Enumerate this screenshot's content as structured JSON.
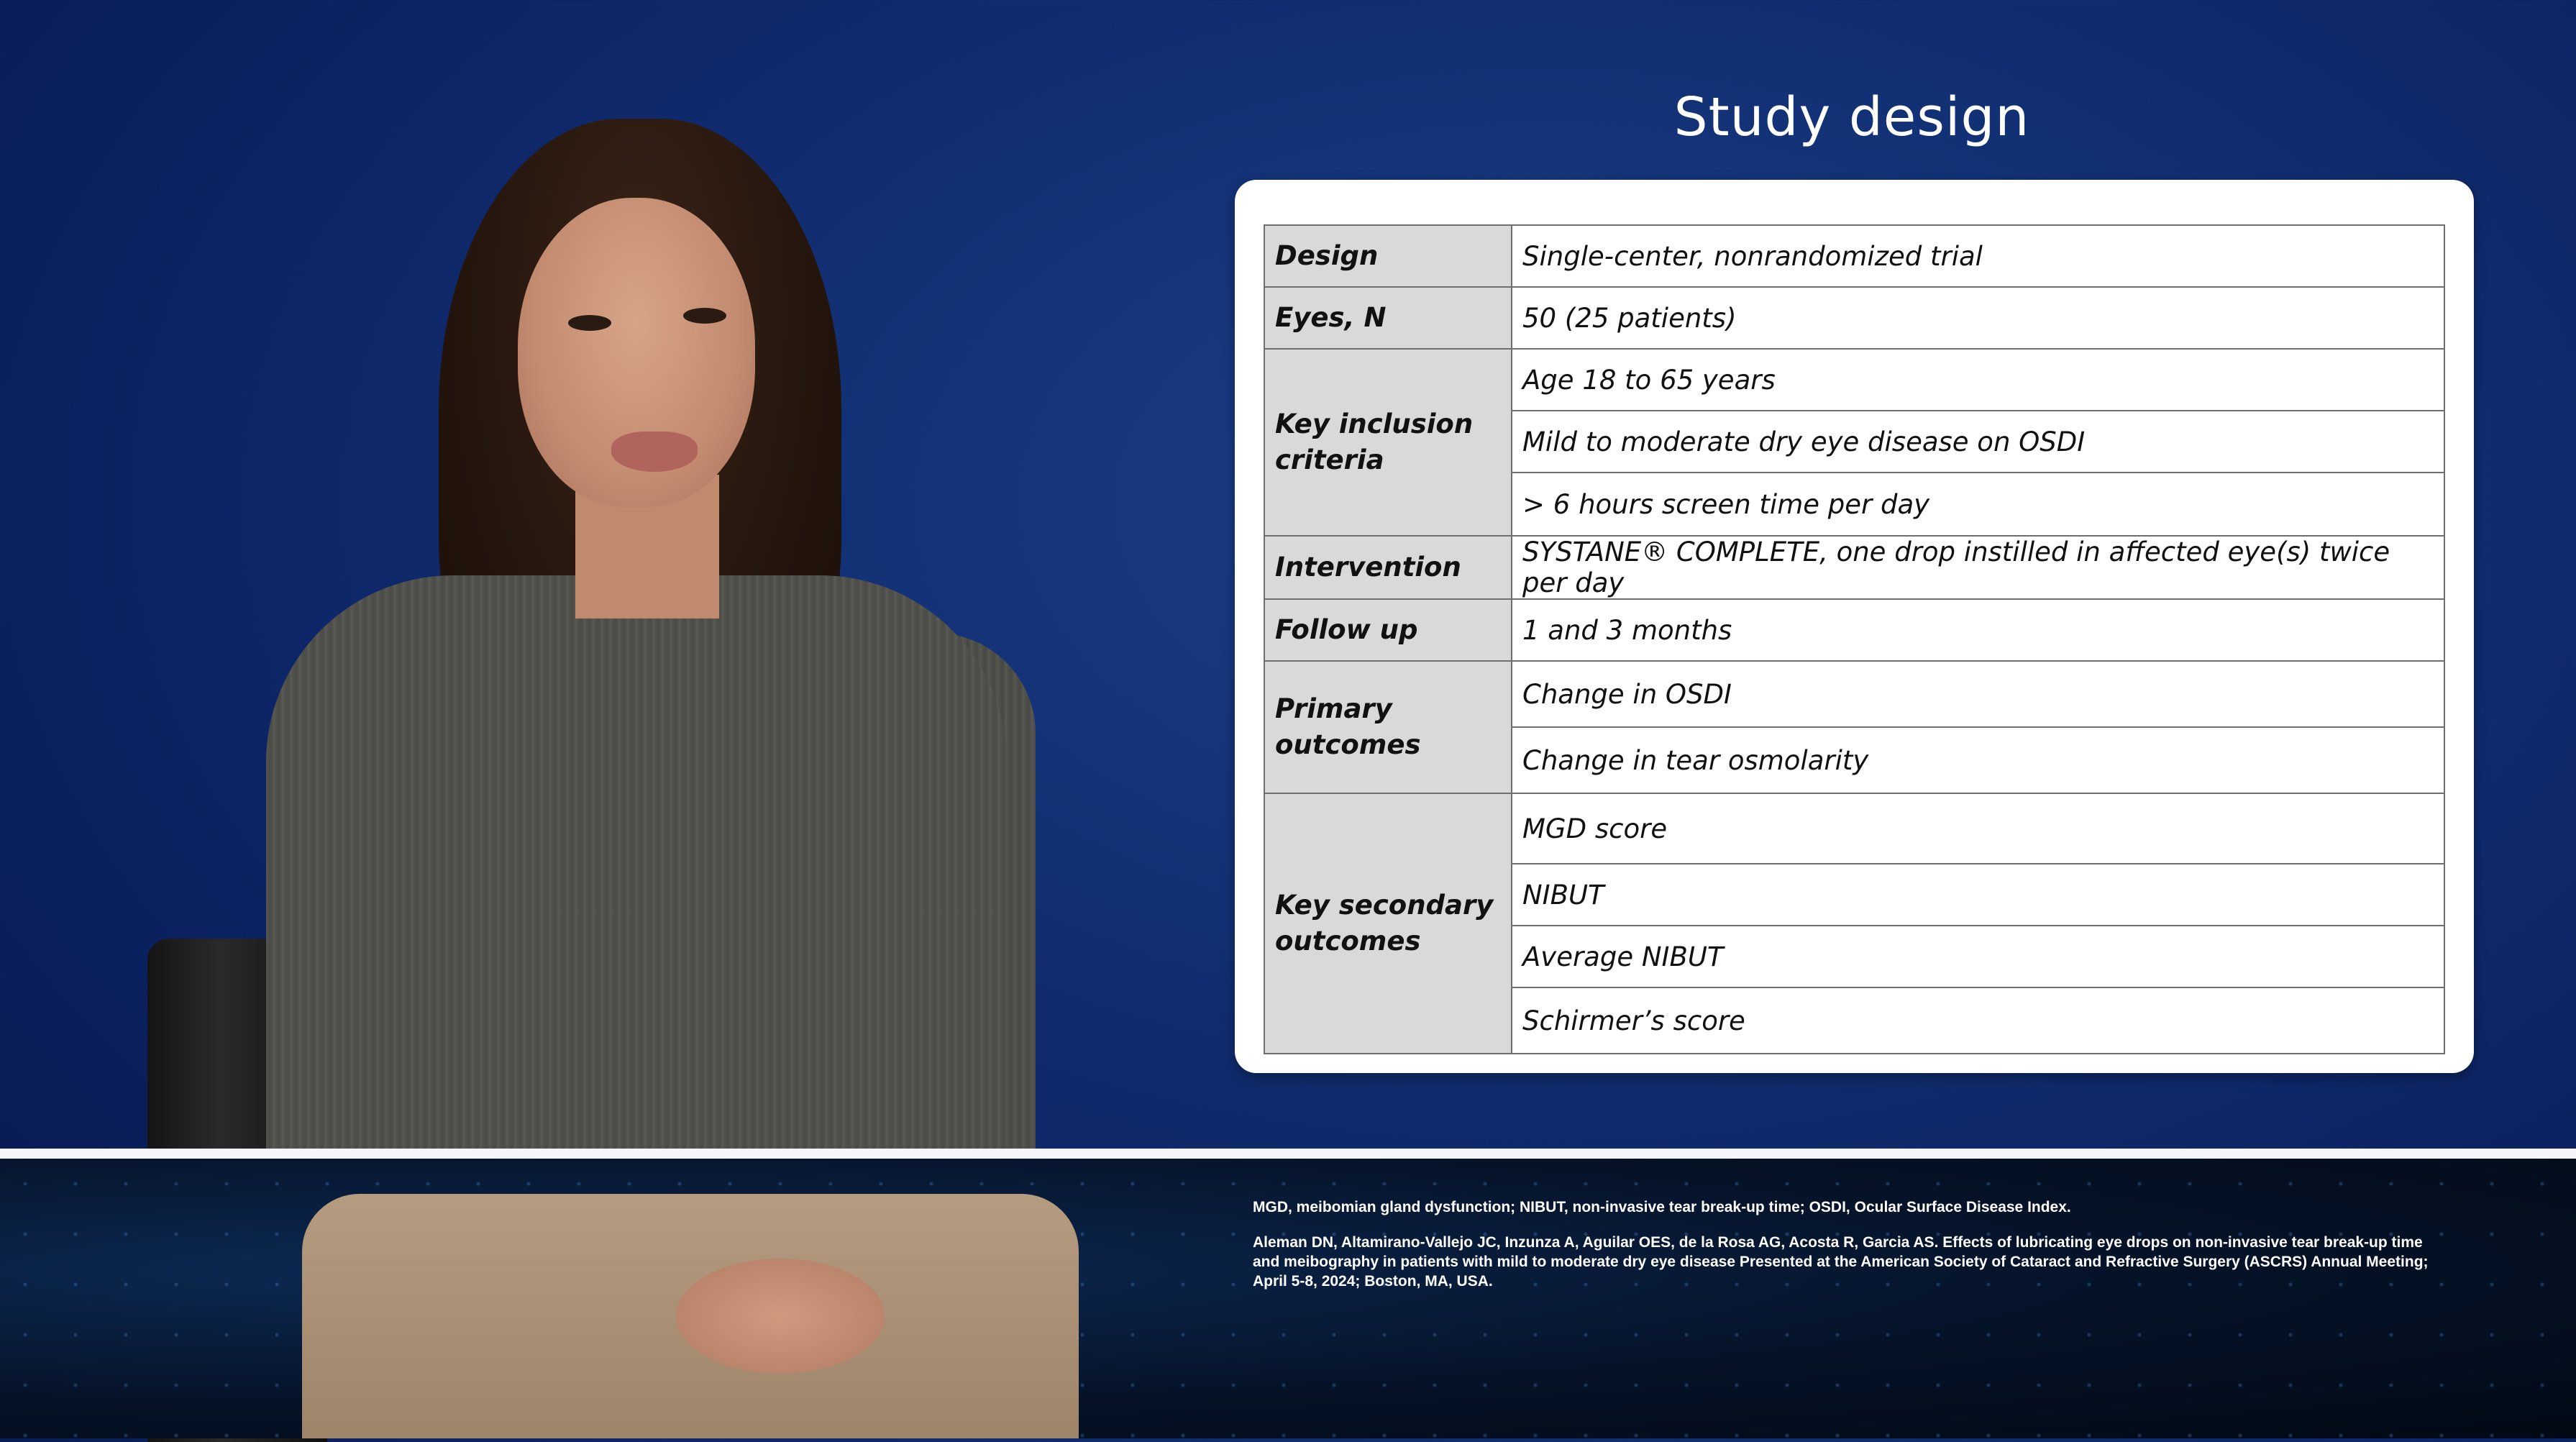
{
  "slide": {
    "title": "Study design"
  },
  "table": {
    "rows": [
      {
        "label": "Design",
        "values": [
          "Single-center, nonrandomized trial"
        ]
      },
      {
        "label": "Eyes, N",
        "values": [
          "50 (25 patients)"
        ]
      },
      {
        "label": "Key inclusion criteria",
        "values": [
          "Age 18 to 65 years",
          "Mild to moderate dry eye disease on OSDI",
          "> 6 hours screen time per day"
        ]
      },
      {
        "label": "Intervention",
        "values": [
          "SYSTANE® COMPLETE, one drop instilled in affected eye(s) twice per day"
        ]
      },
      {
        "label": "Follow up",
        "values": [
          "1 and 3 months"
        ]
      },
      {
        "label": "Primary outcomes",
        "values": [
          "Change in OSDI",
          "Change in tear osmolarity"
        ]
      },
      {
        "label": "Key secondary outcomes",
        "values": [
          "MGD score",
          "NIBUT",
          "Average NIBUT",
          "Schirmer’s score"
        ]
      }
    ]
  },
  "footnotes": {
    "abbreviations": "MGD, meibomian gland dysfunction; NIBUT, non-invasive tear break-up time; OSDI, Ocular Surface Disease Index.",
    "reference": "Aleman DN, Altamirano-Vallejo JC, Inzunza A, Aguilar OES, de la Rosa AG, Acosta R, Garcia AS. Effects of lubricating eye drops on non-invasive tear break-up time and meibography in patients with mild to moderate dry eye disease Presented at the American Society of Cataract and Refractive Surgery (ASCRS) Annual Meeting; April 5-8, 2024; Boston, MA, USA."
  },
  "colors": {
    "background": "#0b2160",
    "table_label_fill": "#d9d9d9",
    "card": "#ffffff"
  }
}
